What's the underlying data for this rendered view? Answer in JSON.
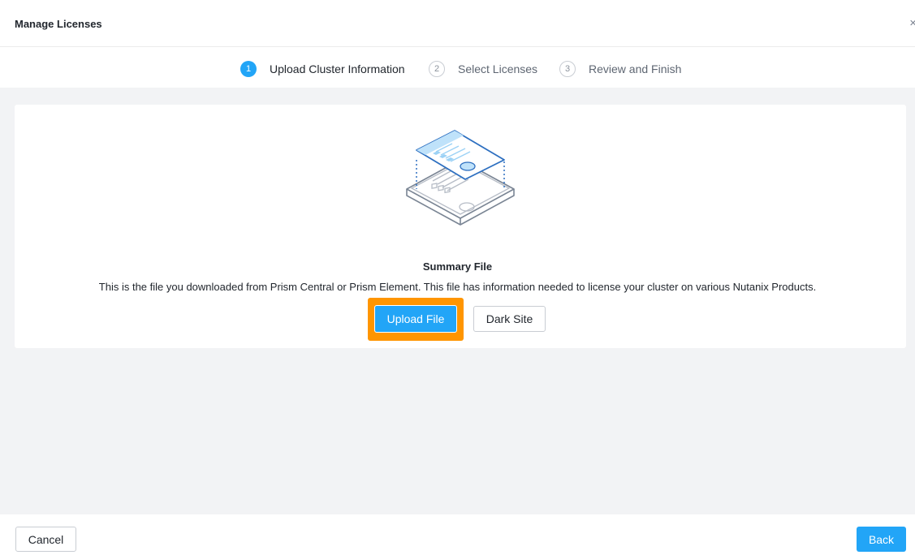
{
  "dialog": {
    "title": "Manage Licenses",
    "close_glyph": "×"
  },
  "steps": [
    {
      "number": "1",
      "label": "Upload Cluster Information",
      "active": true
    },
    {
      "number": "2",
      "label": "Select Licenses",
      "active": false
    },
    {
      "number": "3",
      "label": "Review and Finish",
      "active": false
    }
  ],
  "summary": {
    "title": "Summary File",
    "description": "This is the file you downloaded from Prism Central or Prism Element. This file has information needed to license your cluster on various Nutanix Products.",
    "illustration_icon": "summary-file-illustration-icon"
  },
  "actions": {
    "upload_label": "Upload File",
    "dark_site_label": "Dark Site"
  },
  "footer": {
    "cancel_label": "Cancel",
    "back_label": "Back"
  },
  "colors": {
    "accent": "#22a5f7",
    "highlight": "#ff9500",
    "background": "#f2f3f5"
  }
}
